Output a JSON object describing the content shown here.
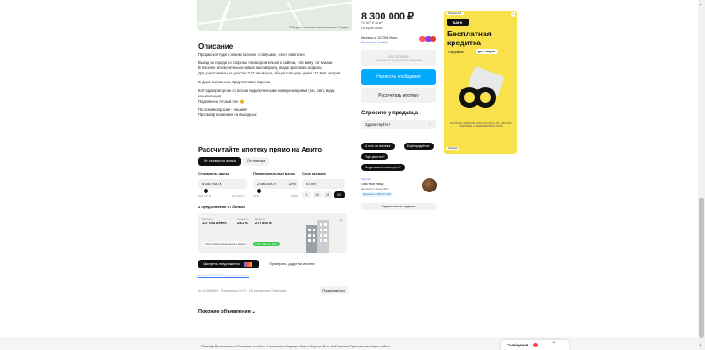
{
  "map": {
    "caption": "© Яндекс  Условия использования  Яндекс"
  },
  "description": {
    "title": "Описание",
    "p1": "Продаю коттедж в новом поселке «Совушки», село «Шигали»",
    "p2": "Выезд из города со стороны Авиастроительного района, ~15 минут от Казани",
    "p3": "В поселке исключительно новый жилой фонд, везде проложен асфальт",
    "p4": "Дом расположен на участке 7,52 кв. метра, общая площадь дома 111,9 кв. метров",
    "p5": "В доме выполнена предчистовая отделка",
    "p6": "Коттедж пристроен со всеми подключенными коммуникациями (газ, свет, вода, канализация)",
    "p7": "Подключен теплый пол 😊",
    "p8": "По всем вопросам - пишите!",
    "p9": "Просмотр возможен на выходных"
  },
  "mortgage": {
    "title": "Рассчитайте ипотеку прямо на Авито",
    "tab1": "От стоимости жилья",
    "tab2": "От платежа",
    "label_cost": "Стоимость жилья",
    "label_initial": "Первоначальный взнос",
    "label_term": "Срок кредита",
    "cost_value": "8 300 000 ₽",
    "initial_value": "2 490 000 ₽",
    "initial_percent": "30%",
    "term_value": "20 лет",
    "cost_min": "500 тыс ₽",
    "cost_max": "100 млн ₽",
    "initial_min": "10%",
    "initial_max": "100%",
    "terms": [
      "5",
      "10",
      "15",
      "20"
    ],
    "offers_title": "2 предложения от банков",
    "offer": {
      "payment_label": "Платеж от",
      "payment": "137 054 ₽/мес",
      "rate_label": "Ставка от",
      "rate": "28.2%",
      "income_label": "Доход от",
      "income": "273 850 ₽",
      "tag1": "−0.3% за бесплатный выпуск по кредиту",
      "tag2": "0,3% ставка по банку"
    },
    "view_button": "Смотреть предложения",
    "check_button": "Проверить, дадут ли ипотеку",
    "terms_link": "Условия использования сервиса ипотеки"
  },
  "meta": {
    "text": "№ 4272986343 · 28 февраля в 10:19 · 236 просмотров (+3 сегодня)",
    "report_button": "Пожаловаться"
  },
  "similar": {
    "title": "Похожие объявления ⌄"
  },
  "sidebar": {
    "price": "8 300 000 ₽",
    "price_per_m": "72 607 ₽ за м²",
    "history": "История цены",
    "mortgage_text": "Ипотека от 137 054 ₽/мес",
    "mortgage_link": "Рассчитать онлайн",
    "no_calls": "Без звонков",
    "no_calls_sub": "Пользователь предпочитает сообщения",
    "write_button": "Написать сообщение",
    "calc_button": "Рассчитать ипотеку",
    "ask_title": "Спросите у продавца",
    "ask_placeholder": "Здравствуйте!",
    "chips": [
      "А есть ли ипотека?",
      "Ещё продаётся?",
      "Торг уместен?",
      "Когда можно посмотреть?"
    ],
    "seller_type": "Частное лицо",
    "seller_since": "На Авито с июня 2017",
    "seller_badge": "Документы · 3000 м² 2024",
    "seller_kind": "Частник",
    "subscribe": "Подписаться на продавца"
  },
  "ad": {
    "label": "Реклама 18+",
    "bank": "БАНК",
    "headline": "Бесплатная кредитка",
    "sub": "Оформите",
    "until": "до 9 марта",
    "fine": "АО «ТБАНК» ЛИЦЕНЗИЯ БАНКА РОССИИ № 2673. РЕКЛАМА. ПОДРОБНЕЕ О ПРЕДЛОЖЕНИИ НА САЙТЕ",
    "corner": "Реклама"
  },
  "footer": {
    "links": "Помощь  Безопасность  Реклама на сайте  О компании  Карьера  Авито Журнал  Блог  #яПомогаю  Приложения  Карта сайта",
    "messages": "Сообщения"
  }
}
